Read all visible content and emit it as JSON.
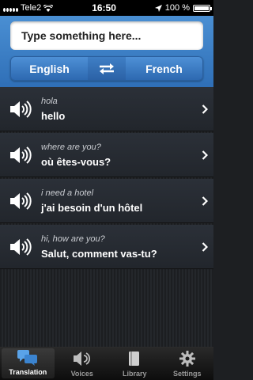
{
  "status": {
    "carrier": "Tele2",
    "time": "16:50",
    "battery": "100 %",
    "battery_level": 1.0
  },
  "search": {
    "placeholder": "Type something here..."
  },
  "languages": {
    "source": "English",
    "target": "French",
    "swap_icon": "swap-arrows-icon"
  },
  "phrases": [
    {
      "source": "hola",
      "translation": "hello"
    },
    {
      "source": "where are you?",
      "translation": "où êtes-vous?"
    },
    {
      "source": "i need a hotel",
      "translation": "j'ai besoin d'un hôtel"
    },
    {
      "source": "hi, how are you?",
      "translation": "Salut, comment vas-tu?"
    }
  ],
  "tabs": [
    {
      "label": "Translation",
      "icon": "speech-bubbles-icon",
      "active": true
    },
    {
      "label": "Voices",
      "icon": "speaker-icon",
      "active": false
    },
    {
      "label": "Library",
      "icon": "book-icon",
      "active": false
    },
    {
      "label": "Settings",
      "icon": "gear-icon",
      "active": false
    }
  ],
  "colors": {
    "header_blue": "#3a7fc8",
    "list_bg": "#22262c",
    "tabbar_bg": "#111111"
  }
}
